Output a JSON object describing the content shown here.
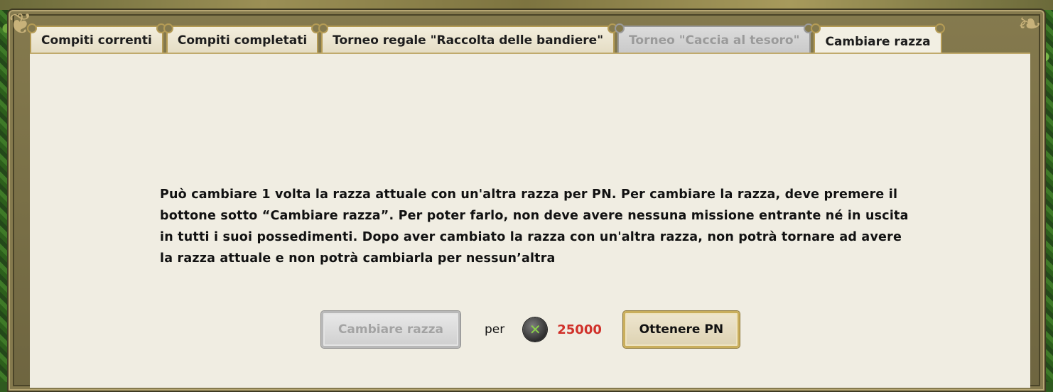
{
  "tabs": [
    {
      "label": "Compiti correnti",
      "state": "normal"
    },
    {
      "label": "Compiti completati",
      "state": "normal"
    },
    {
      "label": "Torneo regale \"Raccolta delle bandiere\"",
      "state": "normal"
    },
    {
      "label": "Torneo \"Caccia al tesoro\"",
      "state": "disabled"
    },
    {
      "label": "Cambiare razza",
      "state": "active"
    }
  ],
  "content": {
    "description": "Può cambiare 1 volta la razza attuale con un'altra razza per PN. Per cambiare la razza, deve premere il bottone sotto “Cambiare razza”. Per poter farlo, non deve avere nessuna missione entrante né in uscita in tutti i suoi possedimenti. Dopo aver cambiato la razza con un'altra razza, non potrà tornare ad avere la razza attuale e non potrà cambiarla per nessun’altra"
  },
  "actions": {
    "change_button_label": "Cambiare razza",
    "per_label": "per",
    "cost_icon": "pn-coin-icon",
    "cost_amount": "25000",
    "get_button_label": "Ottenere PN"
  },
  "colors": {
    "panel_bg": "#f0ede2",
    "frame_gold": "#b49b55",
    "cost_red": "#d0312a",
    "disabled_gray": "#a3a3a3"
  }
}
